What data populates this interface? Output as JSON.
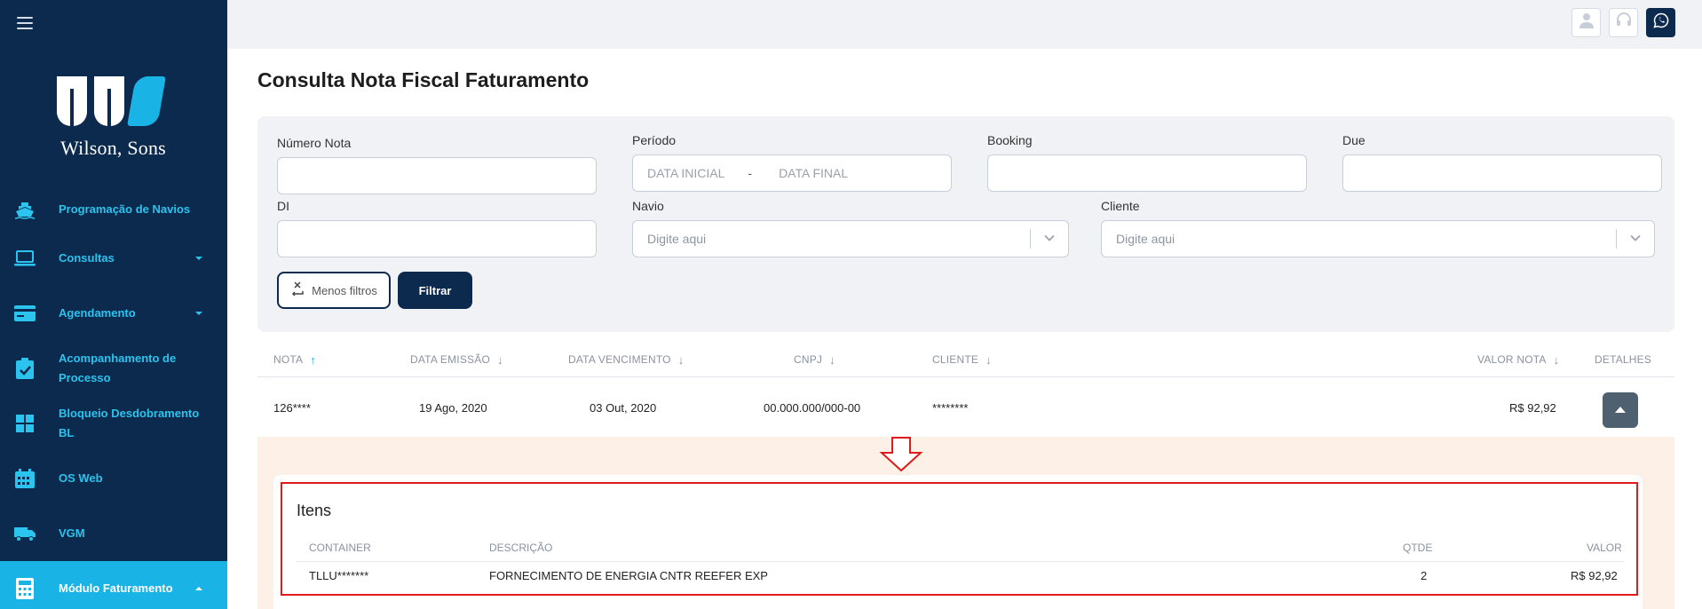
{
  "sidebar": {
    "brand": "Wilson, Sons",
    "menu_icon": "hamburger-menu-icon",
    "items": [
      {
        "label_lines": [
          "Programação de Navios"
        ],
        "icon": "ship-icon",
        "has_caret": false
      },
      {
        "label_lines": [
          "Consultas"
        ],
        "icon": "laptop-icon",
        "has_caret": true
      },
      {
        "label_lines": [
          "Agendamento"
        ],
        "icon": "credit-card-icon",
        "has_caret": true
      },
      {
        "label_lines": [
          "Acompanhamento de",
          "Processo"
        ],
        "icon": "clipboard-check-icon",
        "has_caret": false
      },
      {
        "label_lines": [
          "Bloqueio Desdobramento",
          "BL"
        ],
        "icon": "grid-icon",
        "has_caret": false
      },
      {
        "label_lines": [
          "OS Web"
        ],
        "icon": "calendar-icon",
        "has_caret": false
      },
      {
        "label_lines": [
          "VGM"
        ],
        "icon": "truck-icon",
        "has_caret": false
      },
      {
        "label_lines": [
          "Módulo Faturamento"
        ],
        "icon": "calculator-icon",
        "has_caret": true,
        "active": true
      }
    ]
  },
  "topbar": {
    "icons": [
      "user-icon",
      "headset-icon",
      "whatsapp-icon"
    ]
  },
  "page": {
    "title": "Consulta Nota Fiscal Faturamento"
  },
  "filters": {
    "numero_nota": {
      "label": "Número Nota",
      "value": ""
    },
    "periodo": {
      "label": "Período",
      "start_placeholder": "DATA INICIAL",
      "separator": "-",
      "end_placeholder": "DATA FINAL"
    },
    "booking": {
      "label": "Booking",
      "value": ""
    },
    "due": {
      "label": "Due",
      "value": ""
    },
    "di": {
      "label": "DI",
      "value": ""
    },
    "navio": {
      "label": "Navio",
      "placeholder": "Digite aqui"
    },
    "cliente": {
      "label": "Cliente",
      "placeholder": "Digite aqui"
    },
    "less_filters_label": "Menos filtros",
    "filter_label": "Filtrar"
  },
  "table": {
    "headers": {
      "nota": "NOTA",
      "data_emissao": "DATA EMISSÃO",
      "data_vencimento": "DATA VENCIMENTO",
      "cnpj": "CNPJ",
      "cliente": "CLIENTE",
      "valor_nota": "VALOR NOTA",
      "detalhes": "DETALHES"
    },
    "rows": [
      {
        "nota": "126****",
        "data_emissao": "19 Ago, 2020",
        "data_vencimento": "03 Out, 2020",
        "cnpj": "00.000.000/000-00",
        "cliente": "********",
        "valor_nota": "R$ 92,92"
      }
    ]
  },
  "details": {
    "title": "Itens",
    "headers": {
      "container": "CONTAINER",
      "descricao": "DESCRIÇÃO",
      "qtde": "QTDE",
      "valor": "VALOR"
    },
    "items": [
      {
        "container": "TLLU*******",
        "descricao": "FORNECIMENTO DE ENERGIA CNTR REEFER EXP",
        "qtde": "2",
        "valor": "R$ 92,92"
      }
    ]
  },
  "colors": {
    "sidebar_bg": "#0c2a4d",
    "accent": "#19b3e6",
    "highlight_frame": "#e01b1b",
    "details_bg": "#fdf0e7"
  }
}
